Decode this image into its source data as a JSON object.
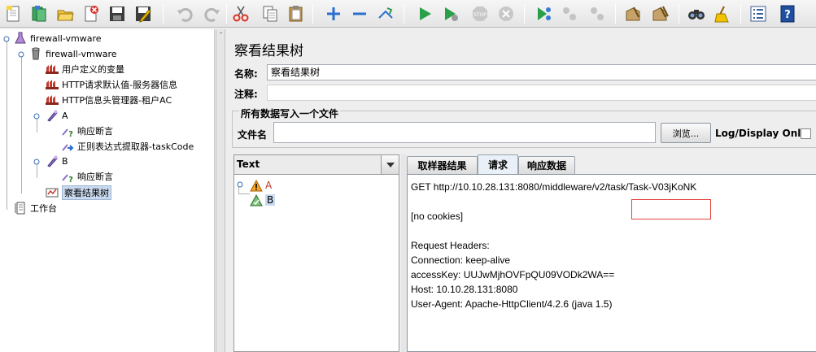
{
  "toolbar": {
    "buttons": [
      "new",
      "templates",
      "open",
      "close",
      "save",
      "save-as",
      "undo",
      "redo",
      "cut",
      "copy",
      "paste",
      "expand",
      "collapse",
      "toggle",
      "start",
      "start-no-pauses",
      "stop",
      "shutdown",
      "remote-start",
      "remote-stop",
      "remote-stop-all",
      "clear",
      "clear-all",
      "search",
      "reset-search",
      "function-helper",
      "help"
    ]
  },
  "tree": {
    "nodes": [
      {
        "label": "firewall-vmware",
        "icon": "test-plan-icon"
      },
      {
        "label": "firewall-vmware",
        "icon": "thread-group-icon"
      },
      {
        "label": "用户定义的变量",
        "icon": "config-element-icon"
      },
      {
        "label": "HTTP请求默认值-服务器信息",
        "icon": "config-element-icon"
      },
      {
        "label": "HTTP信息头管理器-租户AC",
        "icon": "config-element-icon"
      },
      {
        "label": "A",
        "icon": "sampler-icon"
      },
      {
        "label": "响应断言",
        "icon": "assertion-icon"
      },
      {
        "label": "正则表达式提取器-taskCode",
        "icon": "extractor-icon"
      },
      {
        "label": "B",
        "icon": "sampler-icon"
      },
      {
        "label": "响应断言",
        "icon": "assertion-icon"
      },
      {
        "label": "察看结果树",
        "icon": "listener-icon",
        "selected": true
      },
      {
        "label": "工作台",
        "icon": "workbench-icon"
      }
    ]
  },
  "panel": {
    "title": "察看结果树",
    "name_label": "名称:",
    "name_value": "察看结果树",
    "comment_label": "注释:",
    "comment_value": "",
    "file_group_title": "所有数据写入一个文件",
    "filename_label": "文件名",
    "filename_value": "",
    "browse_label": "浏览...",
    "log_display_label": "Log/Display Only:"
  },
  "results": {
    "renderer": "Text",
    "samples": [
      {
        "label": "A",
        "status": "warning",
        "color": "#c0392b"
      },
      {
        "label": "B",
        "status": "success",
        "color": "#000000"
      }
    ]
  },
  "tabs": [
    {
      "label": "取样器结果",
      "active": false
    },
    {
      "label": "请求",
      "active": true
    },
    {
      "label": "响应数据",
      "active": false
    }
  ],
  "request": {
    "get_line": "GET http://10.10.28.131:8080/middleware/v2/task/Task-V03jKoNK",
    "cookies": "[no cookies]",
    "headers_title": "Request Headers:",
    "headers": [
      "Connection: keep-alive",
      "accessKey: UUJwMjhOVFpQU09VODk2WA==",
      "Host: 10.10.28.131:8080",
      "User-Agent: Apache-HttpClient/4.2.6 (java 1.5)"
    ]
  }
}
